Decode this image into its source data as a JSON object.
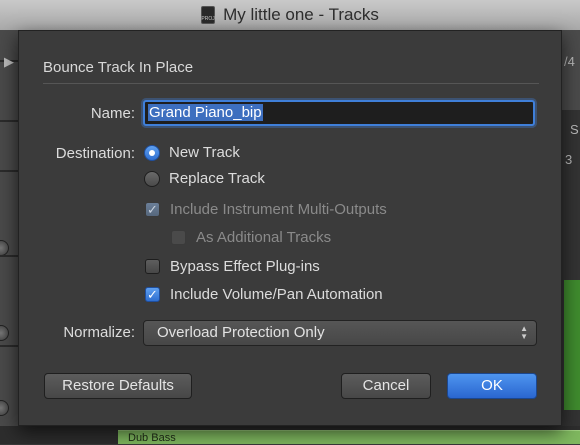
{
  "window": {
    "title": "My little one - Tracks",
    "project_icon": "project-file-icon"
  },
  "background": {
    "region_label": "Dub Bass",
    "top_left_glyph": "▶",
    "top_right_glyph": "/4",
    "right_glyph_2": "S",
    "right_glyph_3": "3"
  },
  "dialog": {
    "title": "Bounce Track In Place",
    "name": {
      "label": "Name:",
      "value": "Grand Piano_bip"
    },
    "destination": {
      "label": "Destination:",
      "options": [
        {
          "label": "New Track",
          "selected": true
        },
        {
          "label": "Replace Track",
          "selected": false
        }
      ]
    },
    "checkboxes": [
      {
        "label": "Include Instrument Multi-Outputs",
        "checked": true,
        "enabled": false
      },
      {
        "label": "As Additional Tracks",
        "checked": false,
        "enabled": false
      },
      {
        "label": "Bypass Effect Plug-ins",
        "checked": false,
        "enabled": true
      },
      {
        "label": "Include Volume/Pan Automation",
        "checked": true,
        "enabled": true
      }
    ],
    "normalize": {
      "label": "Normalize:",
      "value": "Overload Protection Only"
    },
    "buttons": {
      "restore": "Restore Defaults",
      "cancel": "Cancel",
      "ok": "OK"
    }
  },
  "colors": {
    "accent": "#3f7fd9",
    "dialog_bg": "#3b3b3b",
    "region_green": "#7fb85f"
  }
}
